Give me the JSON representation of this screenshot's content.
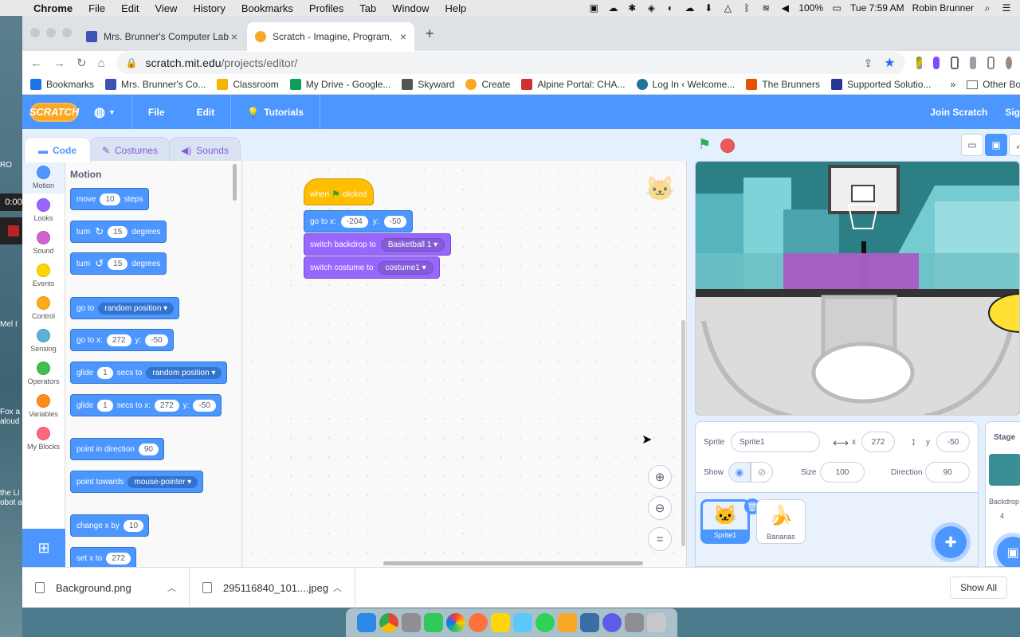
{
  "menubar": {
    "app": "Chrome",
    "items": [
      "File",
      "Edit",
      "View",
      "History",
      "Bookmarks",
      "Profiles",
      "Tab",
      "Window",
      "Help"
    ],
    "battery": "100%",
    "clock": "Tue 7:59 AM",
    "user": "Robin Brunner"
  },
  "desktop": {
    "recording_timer": "0:00",
    "labels": [
      "RO",
      "Mel I",
      "Fox a",
      "aloud",
      "the Li",
      "obot a"
    ]
  },
  "browser": {
    "tabs": [
      {
        "title": "Mrs. Brunner's Computer Lab",
        "color": "#3f51b5"
      },
      {
        "title": "Scratch - Imagine, Program, Sh",
        "color": "#f9a825",
        "active": true
      }
    ],
    "url_host": "scratch.mit.edu",
    "url_path": "/projects/editor/",
    "bookmarks": [
      {
        "label": "Bookmarks",
        "color": "#1a73e8"
      },
      {
        "label": "Mrs. Brunner's Co...",
        "color": "#3f51b5"
      },
      {
        "label": "Classroom",
        "color": "#f4b400"
      },
      {
        "label": "My Drive - Google...",
        "color": "#0f9d58"
      },
      {
        "label": "Skyward",
        "color": "#555555"
      },
      {
        "label": "Create",
        "color": "#f9a825"
      },
      {
        "label": "Alpine Portal: CHA...",
        "color": "#d32f2f"
      },
      {
        "label": "Log In ‹ Welcome...",
        "color": "#21759b"
      },
      {
        "label": "The Brunners",
        "color": "#e65100"
      },
      {
        "label": "Supported Solutio...",
        "color": "#283593"
      }
    ],
    "bookmarks_more": "»",
    "other_bookmarks": "Other Bookma"
  },
  "scratch": {
    "logo": "SCRATCH",
    "menu": {
      "file": "File",
      "edit": "Edit",
      "tutorials": "Tutorials",
      "join": "Join Scratch",
      "signin": "Sig"
    },
    "tabs": {
      "code": "Code",
      "costumes": "Costumes",
      "sounds": "Sounds"
    },
    "categories": [
      {
        "label": "Motion",
        "color": "#4c97ff"
      },
      {
        "label": "Looks",
        "color": "#9966ff"
      },
      {
        "label": "Sound",
        "color": "#cf63cf"
      },
      {
        "label": "Events",
        "color": "#ffd500"
      },
      {
        "label": "Control",
        "color": "#ffab19"
      },
      {
        "label": "Sensing",
        "color": "#5cb1d6"
      },
      {
        "label": "Operators",
        "color": "#40bf4a"
      },
      {
        "label": "Variables",
        "color": "#ff8c1a"
      },
      {
        "label": "My Blocks",
        "color": "#ff6680"
      }
    ],
    "palette": {
      "title": "Motion",
      "move": {
        "t1": "move",
        "n": "10",
        "t2": "steps"
      },
      "turn_cw": {
        "t1": "turn",
        "n": "15",
        "t2": "degrees"
      },
      "turn_ccw": {
        "t1": "turn",
        "n": "15",
        "t2": "degrees"
      },
      "goto_target": {
        "t1": "go to",
        "dd": "random position"
      },
      "goto_xy": {
        "t1": "go to x:",
        "x": "272",
        "t2": "y:",
        "y": "-50"
      },
      "glide_target": {
        "t1": "glide",
        "n": "1",
        "t2": "secs to",
        "dd": "random position"
      },
      "glide_xy": {
        "t1": "glide",
        "n": "1",
        "t2": "secs to x:",
        "x": "272",
        "t3": "y:",
        "y": "-50"
      },
      "point_dir": {
        "t1": "point in direction",
        "n": "90"
      },
      "point_towards": {
        "t1": "point towards",
        "dd": "mouse-pointer"
      },
      "change_x": {
        "t1": "change x by",
        "n": "10"
      },
      "set_x": {
        "t1": "set x to",
        "n": "272"
      }
    },
    "script": {
      "hat": {
        "t1": "when",
        "t2": "clicked"
      },
      "goto": {
        "t1": "go to x:",
        "x": "-204",
        "t2": "y:",
        "y": "-50"
      },
      "backdrop": {
        "t1": "switch backdrop to",
        "dd": "Basketball 1"
      },
      "costume": {
        "t1": "switch costume to",
        "dd": "costume1"
      }
    },
    "sprite_info": {
      "sprite_label": "Sprite",
      "sprite_name": "Sprite1",
      "x_label": "x",
      "x": "272",
      "y_label": "y",
      "y": "-50",
      "show_label": "Show",
      "size_label": "Size",
      "size": "100",
      "direction_label": "Direction",
      "direction": "90"
    },
    "sprites": [
      {
        "name": "Sprite1",
        "selected": true
      },
      {
        "name": "Bananas",
        "selected": false
      }
    ],
    "stage_panel": {
      "title": "Stage",
      "backdrops_label": "Backdrop",
      "backdrops_count": "4"
    }
  },
  "downloads": [
    {
      "name": "Background.png"
    },
    {
      "name": "295116840_101....jpeg"
    }
  ],
  "downloads_show_all": "Show All"
}
